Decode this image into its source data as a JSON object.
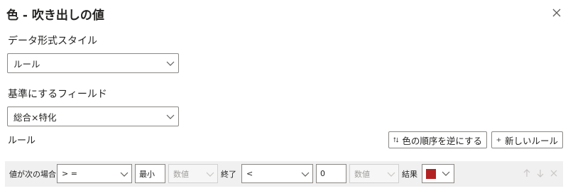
{
  "dialog": {
    "title": "色 - 吹き出しの値"
  },
  "format_style": {
    "label": "データ形式スタイル",
    "value": "ルール"
  },
  "based_on_field": {
    "label": "基準にするフィールド",
    "value": "総合×特化"
  },
  "rules": {
    "label": "ルール",
    "reverse_order_label": "色の順序を逆にする",
    "new_rule_label": "新しいルール"
  },
  "rule_row": {
    "if_value_label": "値が次の場合",
    "operator1": "> =",
    "value1": "最小",
    "type1": "数値",
    "and_label": "終了",
    "operator2": "<",
    "value2": "0",
    "type2": "数値",
    "then_label": "結果",
    "color": "#b22222"
  },
  "colors": {
    "border": "#8a8886",
    "row_bg": "#f0f0f0",
    "disabled_icon": "#c8c6c4"
  },
  "icons": [
    "close-icon",
    "chevron-down-icon",
    "sort-arrows-icon",
    "plus-icon",
    "arrow-up-icon",
    "arrow-down-icon",
    "delete-icon"
  ]
}
